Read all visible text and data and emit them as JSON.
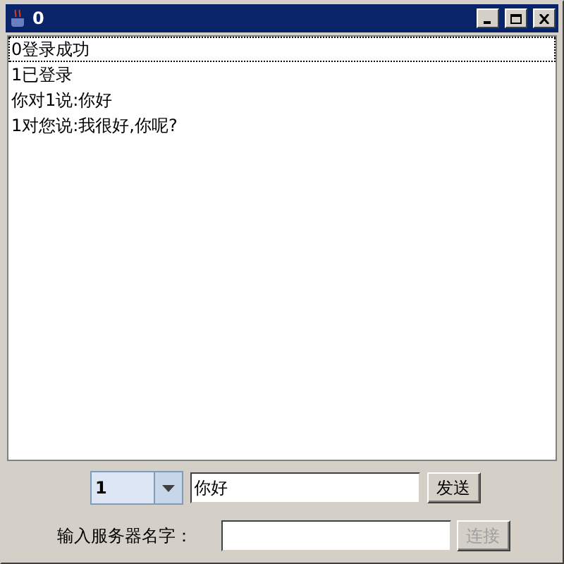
{
  "window": {
    "title": "0"
  },
  "messages": [
    {
      "text": "0登录成功",
      "selected": true
    },
    {
      "text": "1已登录",
      "selected": false
    },
    {
      "text": "你对1说:你好",
      "selected": false
    },
    {
      "text": "1对您说:我很好,你呢?",
      "selected": false
    }
  ],
  "send_row": {
    "recipient": "1",
    "message": "你好",
    "button": {
      "label": "发送",
      "disabled": false
    }
  },
  "connect_row": {
    "label": "输入服务器名字：",
    "button": {
      "label": "连接",
      "disabled": true
    }
  }
}
